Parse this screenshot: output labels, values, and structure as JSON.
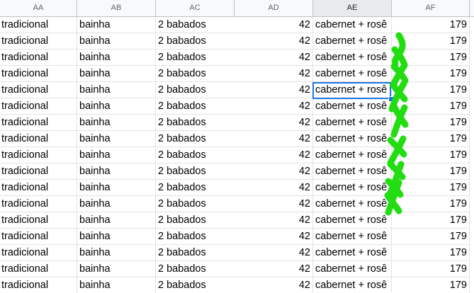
{
  "columns": [
    "AA",
    "AB",
    "AC",
    "AD",
    "AE",
    "AF"
  ],
  "active_column": "AE",
  "rows": [
    [
      "tradicional",
      "bainha",
      "2 babados",
      "42",
      "cabernet + rosê",
      "179"
    ],
    [
      "tradicional",
      "bainha",
      "2 babados",
      "42",
      "cabernet + rosê",
      "179"
    ],
    [
      "tradicional",
      "bainha",
      "2 babados",
      "42",
      "cabernet + rosê",
      "179"
    ],
    [
      "tradicional",
      "bainha",
      "2 babados",
      "42",
      "cabernet + rosê",
      "179"
    ],
    [
      "tradicional",
      "bainha",
      "2 babados",
      "42",
      "cabernet + rosê",
      "179"
    ],
    [
      "tradicional",
      "bainha",
      "2 babados",
      "42",
      "cabernet + rosê",
      "179"
    ],
    [
      "tradicional",
      "bainha",
      "2 babados",
      "42",
      "cabernet + rosê",
      "179"
    ],
    [
      "tradicional",
      "bainha",
      "2 babados",
      "42",
      "cabernet + rosê",
      "179"
    ],
    [
      "tradicional",
      "bainha",
      "2 babados",
      "42",
      "cabernet + rosê",
      "179"
    ],
    [
      "tradicional",
      "bainha",
      "2 babados",
      "42",
      "cabernet + rosê",
      "179"
    ],
    [
      "tradicional",
      "bainha",
      "2 babados",
      "42",
      "cabernet + rosê",
      "179"
    ],
    [
      "tradicional",
      "bainha",
      "2 babados",
      "42",
      "cabernet + rosê",
      "179"
    ],
    [
      "tradicional",
      "bainha",
      "2 babados",
      "42",
      "cabernet + rosê",
      "179"
    ],
    [
      "tradicional",
      "bainha",
      "2 babados",
      "42",
      "cabernet + rosê",
      "179"
    ],
    [
      "tradicional",
      "bainha",
      "2 babados",
      "42",
      "cabernet + rosê",
      "179"
    ],
    [
      "tradicional",
      "bainha",
      "2 babados",
      "42",
      "cabernet + rosê",
      "179"
    ],
    [
      "tradicional",
      "bainha",
      "2 babados",
      "42",
      "cabernet + rosê",
      "179"
    ]
  ],
  "colors": {
    "selection": "#1a73e8",
    "scribble": "#22dd11",
    "header_bg": "#f8f9fa",
    "gridline": "#e2e2e2"
  }
}
